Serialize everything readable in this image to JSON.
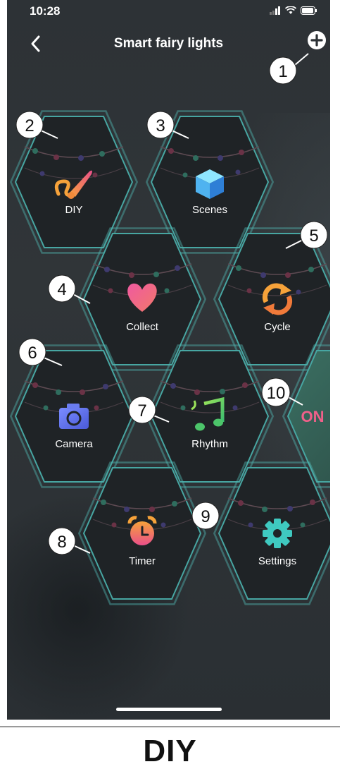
{
  "status_bar": {
    "time": "10:28"
  },
  "nav": {
    "title": "Smart fairy lights"
  },
  "tiles": [
    {
      "id": "diy",
      "label": "DIY",
      "icon": "paintbrush-icon"
    },
    {
      "id": "scenes",
      "label": "Scenes",
      "icon": "cube-icon"
    },
    {
      "id": "collect",
      "label": "Collect",
      "icon": "heart-icon"
    },
    {
      "id": "cycle",
      "label": "Cycle",
      "icon": "cycle-arrows-icon"
    },
    {
      "id": "camera",
      "label": "Camera",
      "icon": "camera-icon"
    },
    {
      "id": "rhythm",
      "label": "Rhythm",
      "icon": "music-notes-icon"
    },
    {
      "id": "power",
      "label": "ON"
    },
    {
      "id": "timer",
      "label": "Timer",
      "icon": "alarm-clock-icon"
    },
    {
      "id": "settings",
      "label": "Settings",
      "icon": "gear-icon"
    }
  ],
  "callouts": [
    "1",
    "2",
    "3",
    "4",
    "5",
    "6",
    "7",
    "8",
    "9",
    "10"
  ],
  "caption": "DIY",
  "colors": {
    "accent": "#4fb3b0",
    "on": "#f0608a",
    "background": "#2f3437"
  }
}
